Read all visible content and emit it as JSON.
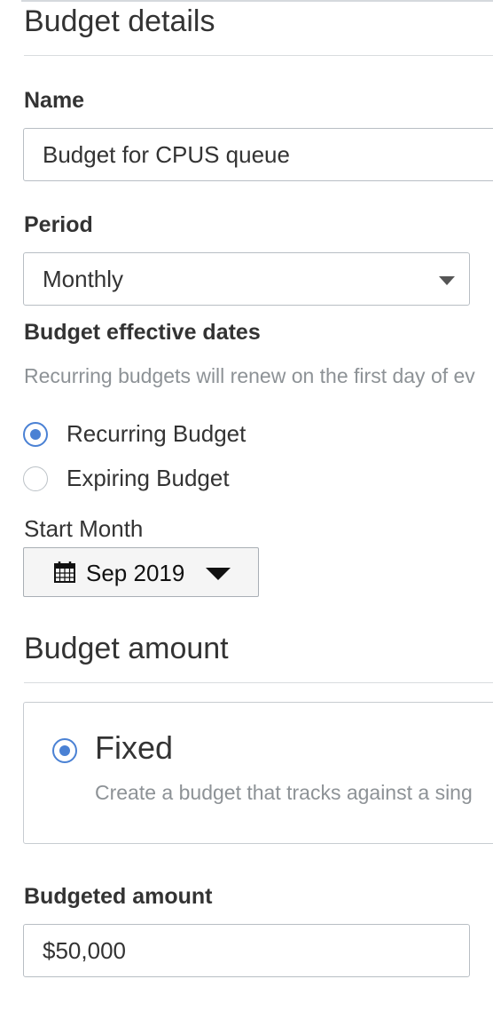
{
  "budget_details": {
    "title": "Budget details",
    "name_label": "Name",
    "name_value": "Budget for CPUS queue",
    "period_label": "Period",
    "period_value": "Monthly"
  },
  "effective_dates": {
    "title": "Budget effective dates",
    "helper_text": "Recurring budgets will renew on the first day of ev",
    "options": [
      {
        "label": "Recurring Budget",
        "checked": true
      },
      {
        "label": "Expiring Budget",
        "checked": false
      }
    ],
    "start_month_label": "Start Month",
    "start_month_value": "Sep 2019"
  },
  "budget_amount": {
    "title": "Budget amount",
    "fixed_title": "Fixed",
    "fixed_description": "Create a budget that tracks against a sing",
    "budgeted_amount_label": "Budgeted amount",
    "budgeted_amount_value": "$50,000"
  },
  "colors": {
    "accent": "#4a81d4",
    "text": "#333333",
    "muted_text": "#8d9296",
    "border": "#b8bec4"
  }
}
